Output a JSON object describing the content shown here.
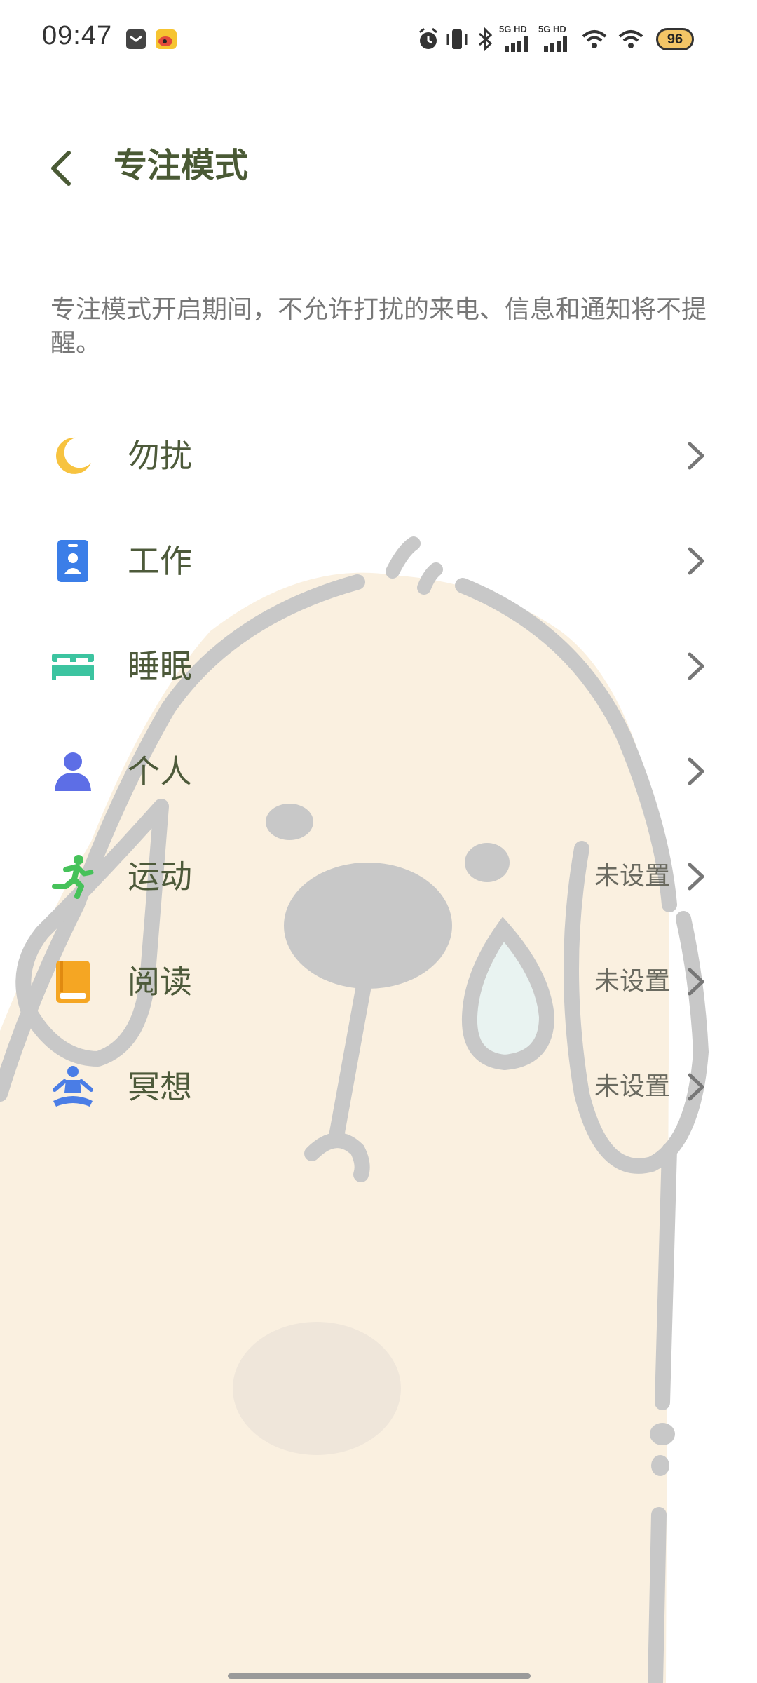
{
  "status_bar": {
    "time": "09:47",
    "icons": [
      "message-icon",
      "weibo-icon",
      "alarm-icon",
      "vibrate-icon",
      "bluetooth-icon",
      "signal-5g-hd-icon",
      "signal-5g-hd-icon",
      "wifi-icon",
      "wifi-icon",
      "battery-icon"
    ],
    "signal_labels": [
      "5G HD",
      "5G HD"
    ],
    "battery_level": "96"
  },
  "header": {
    "title": "专注模式"
  },
  "description": "专注模式开启期间，不允许打扰的来电、信息和通知将不提醒。",
  "modes": [
    {
      "label": "勿扰",
      "status": "",
      "icon": "moon-icon",
      "color": "#f7c340"
    },
    {
      "label": "工作",
      "status": "",
      "icon": "badge-icon",
      "color": "#3b7ee8"
    },
    {
      "label": "睡眠",
      "status": "",
      "icon": "bed-icon",
      "color": "#3cc4a0"
    },
    {
      "label": "个人",
      "status": "",
      "icon": "person-icon",
      "color": "#5d6ee6"
    },
    {
      "label": "运动",
      "status": "未设置",
      "icon": "running-icon",
      "color": "#46c25a"
    },
    {
      "label": "阅读",
      "status": "未设置",
      "icon": "book-icon",
      "color": "#f5a623"
    },
    {
      "label": "冥想",
      "status": "未设置",
      "icon": "meditation-icon",
      "color": "#4a7de6"
    }
  ]
}
